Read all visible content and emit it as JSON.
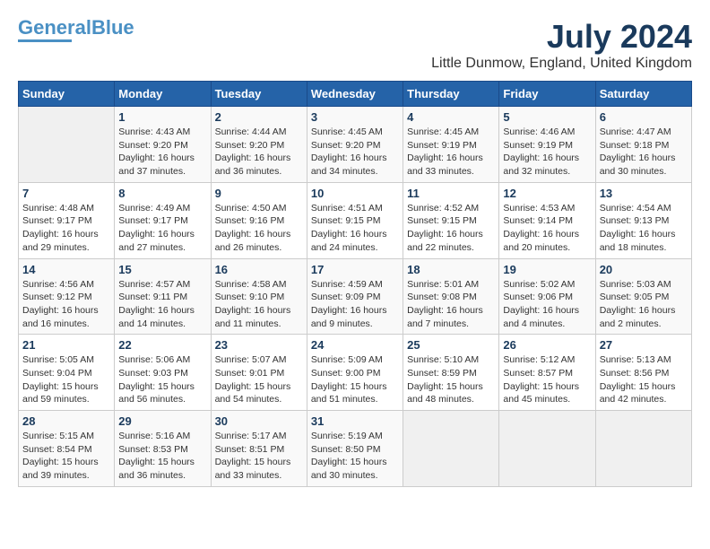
{
  "logo": {
    "line1": "General",
    "line2": "Blue"
  },
  "title": "July 2024",
  "location": "Little Dunmow, England, United Kingdom",
  "headers": [
    "Sunday",
    "Monday",
    "Tuesday",
    "Wednesday",
    "Thursday",
    "Friday",
    "Saturday"
  ],
  "weeks": [
    [
      {
        "day": "",
        "info": ""
      },
      {
        "day": "1",
        "info": "Sunrise: 4:43 AM\nSunset: 9:20 PM\nDaylight: 16 hours\nand 37 minutes."
      },
      {
        "day": "2",
        "info": "Sunrise: 4:44 AM\nSunset: 9:20 PM\nDaylight: 16 hours\nand 36 minutes."
      },
      {
        "day": "3",
        "info": "Sunrise: 4:45 AM\nSunset: 9:20 PM\nDaylight: 16 hours\nand 34 minutes."
      },
      {
        "day": "4",
        "info": "Sunrise: 4:45 AM\nSunset: 9:19 PM\nDaylight: 16 hours\nand 33 minutes."
      },
      {
        "day": "5",
        "info": "Sunrise: 4:46 AM\nSunset: 9:19 PM\nDaylight: 16 hours\nand 32 minutes."
      },
      {
        "day": "6",
        "info": "Sunrise: 4:47 AM\nSunset: 9:18 PM\nDaylight: 16 hours\nand 30 minutes."
      }
    ],
    [
      {
        "day": "7",
        "info": "Sunrise: 4:48 AM\nSunset: 9:17 PM\nDaylight: 16 hours\nand 29 minutes."
      },
      {
        "day": "8",
        "info": "Sunrise: 4:49 AM\nSunset: 9:17 PM\nDaylight: 16 hours\nand 27 minutes."
      },
      {
        "day": "9",
        "info": "Sunrise: 4:50 AM\nSunset: 9:16 PM\nDaylight: 16 hours\nand 26 minutes."
      },
      {
        "day": "10",
        "info": "Sunrise: 4:51 AM\nSunset: 9:15 PM\nDaylight: 16 hours\nand 24 minutes."
      },
      {
        "day": "11",
        "info": "Sunrise: 4:52 AM\nSunset: 9:15 PM\nDaylight: 16 hours\nand 22 minutes."
      },
      {
        "day": "12",
        "info": "Sunrise: 4:53 AM\nSunset: 9:14 PM\nDaylight: 16 hours\nand 20 minutes."
      },
      {
        "day": "13",
        "info": "Sunrise: 4:54 AM\nSunset: 9:13 PM\nDaylight: 16 hours\nand 18 minutes."
      }
    ],
    [
      {
        "day": "14",
        "info": "Sunrise: 4:56 AM\nSunset: 9:12 PM\nDaylight: 16 hours\nand 16 minutes."
      },
      {
        "day": "15",
        "info": "Sunrise: 4:57 AM\nSunset: 9:11 PM\nDaylight: 16 hours\nand 14 minutes."
      },
      {
        "day": "16",
        "info": "Sunrise: 4:58 AM\nSunset: 9:10 PM\nDaylight: 16 hours\nand 11 minutes."
      },
      {
        "day": "17",
        "info": "Sunrise: 4:59 AM\nSunset: 9:09 PM\nDaylight: 16 hours\nand 9 minutes."
      },
      {
        "day": "18",
        "info": "Sunrise: 5:01 AM\nSunset: 9:08 PM\nDaylight: 16 hours\nand 7 minutes."
      },
      {
        "day": "19",
        "info": "Sunrise: 5:02 AM\nSunset: 9:06 PM\nDaylight: 16 hours\nand 4 minutes."
      },
      {
        "day": "20",
        "info": "Sunrise: 5:03 AM\nSunset: 9:05 PM\nDaylight: 16 hours\nand 2 minutes."
      }
    ],
    [
      {
        "day": "21",
        "info": "Sunrise: 5:05 AM\nSunset: 9:04 PM\nDaylight: 15 hours\nand 59 minutes."
      },
      {
        "day": "22",
        "info": "Sunrise: 5:06 AM\nSunset: 9:03 PM\nDaylight: 15 hours\nand 56 minutes."
      },
      {
        "day": "23",
        "info": "Sunrise: 5:07 AM\nSunset: 9:01 PM\nDaylight: 15 hours\nand 54 minutes."
      },
      {
        "day": "24",
        "info": "Sunrise: 5:09 AM\nSunset: 9:00 PM\nDaylight: 15 hours\nand 51 minutes."
      },
      {
        "day": "25",
        "info": "Sunrise: 5:10 AM\nSunset: 8:59 PM\nDaylight: 15 hours\nand 48 minutes."
      },
      {
        "day": "26",
        "info": "Sunrise: 5:12 AM\nSunset: 8:57 PM\nDaylight: 15 hours\nand 45 minutes."
      },
      {
        "day": "27",
        "info": "Sunrise: 5:13 AM\nSunset: 8:56 PM\nDaylight: 15 hours\nand 42 minutes."
      }
    ],
    [
      {
        "day": "28",
        "info": "Sunrise: 5:15 AM\nSunset: 8:54 PM\nDaylight: 15 hours\nand 39 minutes."
      },
      {
        "day": "29",
        "info": "Sunrise: 5:16 AM\nSunset: 8:53 PM\nDaylight: 15 hours\nand 36 minutes."
      },
      {
        "day": "30",
        "info": "Sunrise: 5:17 AM\nSunset: 8:51 PM\nDaylight: 15 hours\nand 33 minutes."
      },
      {
        "day": "31",
        "info": "Sunrise: 5:19 AM\nSunset: 8:50 PM\nDaylight: 15 hours\nand 30 minutes."
      },
      {
        "day": "",
        "info": ""
      },
      {
        "day": "",
        "info": ""
      },
      {
        "day": "",
        "info": ""
      }
    ]
  ]
}
